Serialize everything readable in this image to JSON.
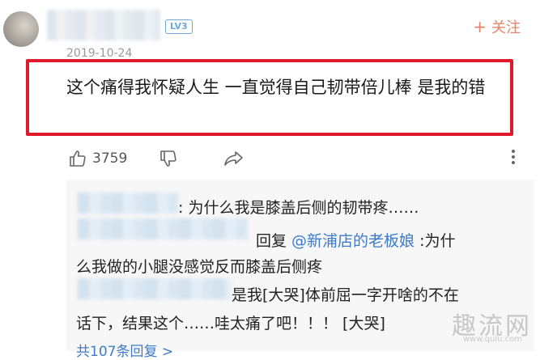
{
  "comment": {
    "level_badge": "LV3",
    "follow_label": "关注",
    "date": "2019-10-24",
    "text": "这个痛得我怀疑人生 一直觉得自己韧带倍儿棒 是我的错",
    "like_count": "3759"
  },
  "replies": {
    "reply1_text": ": 为什么我是膝盖后侧的韧带疼……",
    "reply2_prefix": "回复 ",
    "reply2_mention": "@新浦店的老板娘",
    "reply2_text": " :为什",
    "reply2_cont": "么我做的小腿没感觉反而膝盖后侧疼",
    "reply3_text": "是我[大哭]体前屈一字开啥的不在",
    "reply3_cont": "话下，结果这个……哇太痛了吧！！！ [大哭]",
    "more_replies": "共107条回复 >"
  },
  "watermark": {
    "text": "趣流网",
    "url": "www.qulu.com"
  },
  "colors": {
    "highlight": "#e0182b",
    "follow": "#e5846a",
    "link": "#3d7bc7",
    "badge": "#6fa8dc"
  }
}
